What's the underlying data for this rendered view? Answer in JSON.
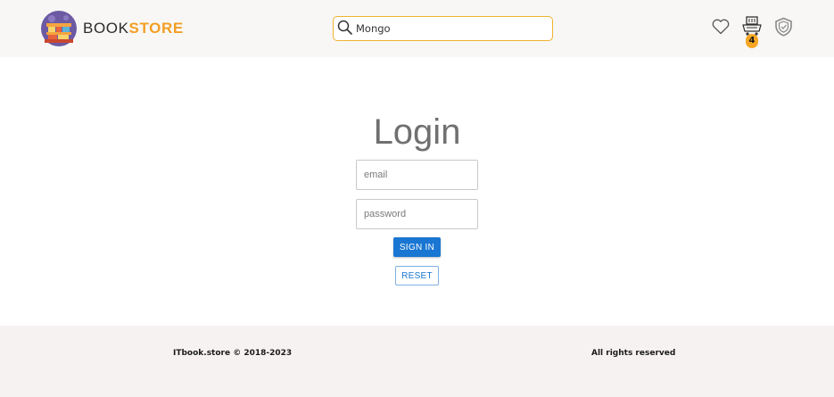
{
  "header": {
    "brand_prefix": "BOOK",
    "brand_suffix": "STORE",
    "search": {
      "value": "Mongo"
    },
    "cart_count": "4",
    "icons": [
      "bookstore-logo-icon",
      "search-icon",
      "heart-icon",
      "shopping-cart-icon",
      "shield-icon"
    ]
  },
  "login": {
    "title": "Login",
    "email_placeholder": "email",
    "password_placeholder": "password",
    "signin_label": "SIGN IN",
    "reset_label": "RESET"
  },
  "footer": {
    "copyright": "ITbook.store © 2018-2023",
    "rights": "All rights reserved"
  },
  "colors": {
    "accent": "#f29f23",
    "primary_button": "#1976d2",
    "search_border": "#efb332",
    "title_text": "#707070"
  }
}
